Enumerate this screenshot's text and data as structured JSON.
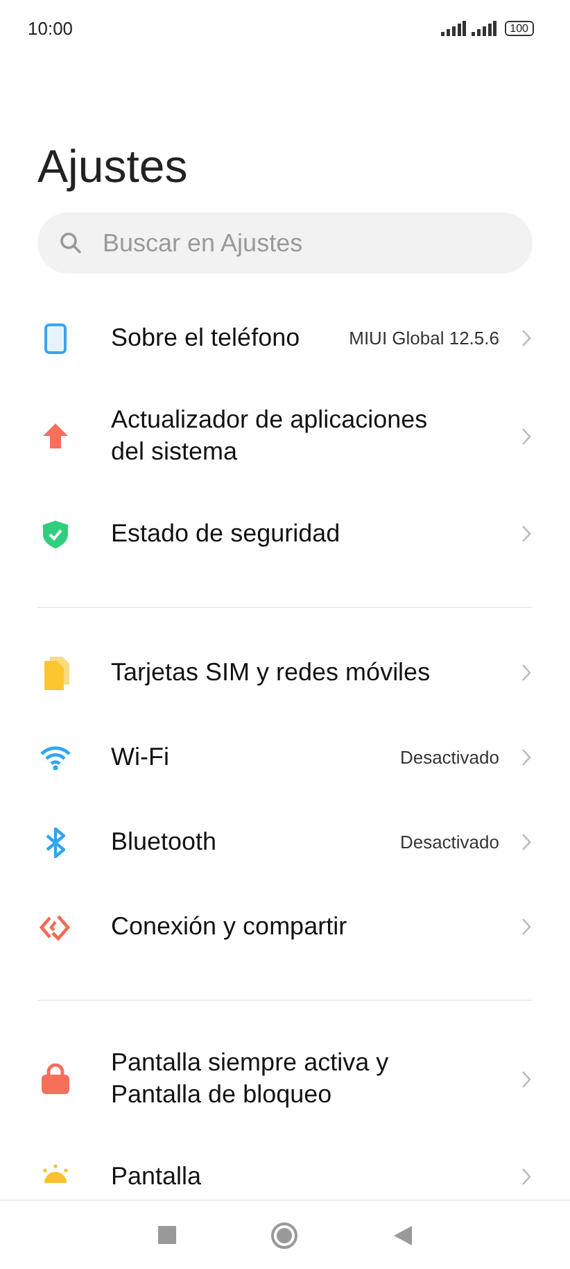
{
  "status_bar": {
    "time": "10:00",
    "battery": "100"
  },
  "title": "Ajustes",
  "search": {
    "placeholder": "Buscar en Ajustes"
  },
  "sections": [
    {
      "items": [
        {
          "label": "Sobre el teléfono",
          "value": "MIUI Global 12.5.6"
        },
        {
          "label": "Actualizador de aplicaciones del sistema"
        },
        {
          "label": "Estado de seguridad"
        }
      ]
    },
    {
      "items": [
        {
          "label": "Tarjetas SIM y redes móviles"
        },
        {
          "label": "Wi-Fi",
          "value": "Desactivado"
        },
        {
          "label": "Bluetooth",
          "value": "Desactivado"
        },
        {
          "label": "Conexión y compartir"
        }
      ]
    },
    {
      "items": [
        {
          "label": "Pantalla siempre activa y Pantalla de bloqueo"
        },
        {
          "label": "Pantalla"
        }
      ]
    }
  ]
}
